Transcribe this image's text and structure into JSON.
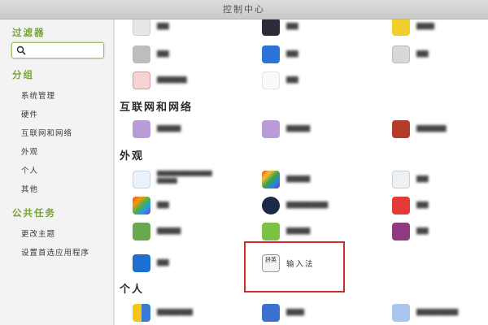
{
  "window": {
    "title": "控制中心"
  },
  "sidebar": {
    "filter_heading": "过滤器",
    "search": {
      "value": "",
      "placeholder": ""
    },
    "group_heading": "分组",
    "groups": [
      "系统管理",
      "硬件",
      "互联网和网络",
      "外观",
      "个人",
      "其他"
    ],
    "tasks_heading": "公共任务",
    "tasks": [
      "更改主题",
      "设置首选应用程序"
    ]
  },
  "main": {
    "sections": [
      "互联网和网络",
      "外观",
      "个人"
    ],
    "input_method": {
      "label": "输入法",
      "icon_text": "拼英"
    }
  },
  "colors": {
    "accent": "#74a334",
    "highlight_border": "#d02a2a"
  }
}
